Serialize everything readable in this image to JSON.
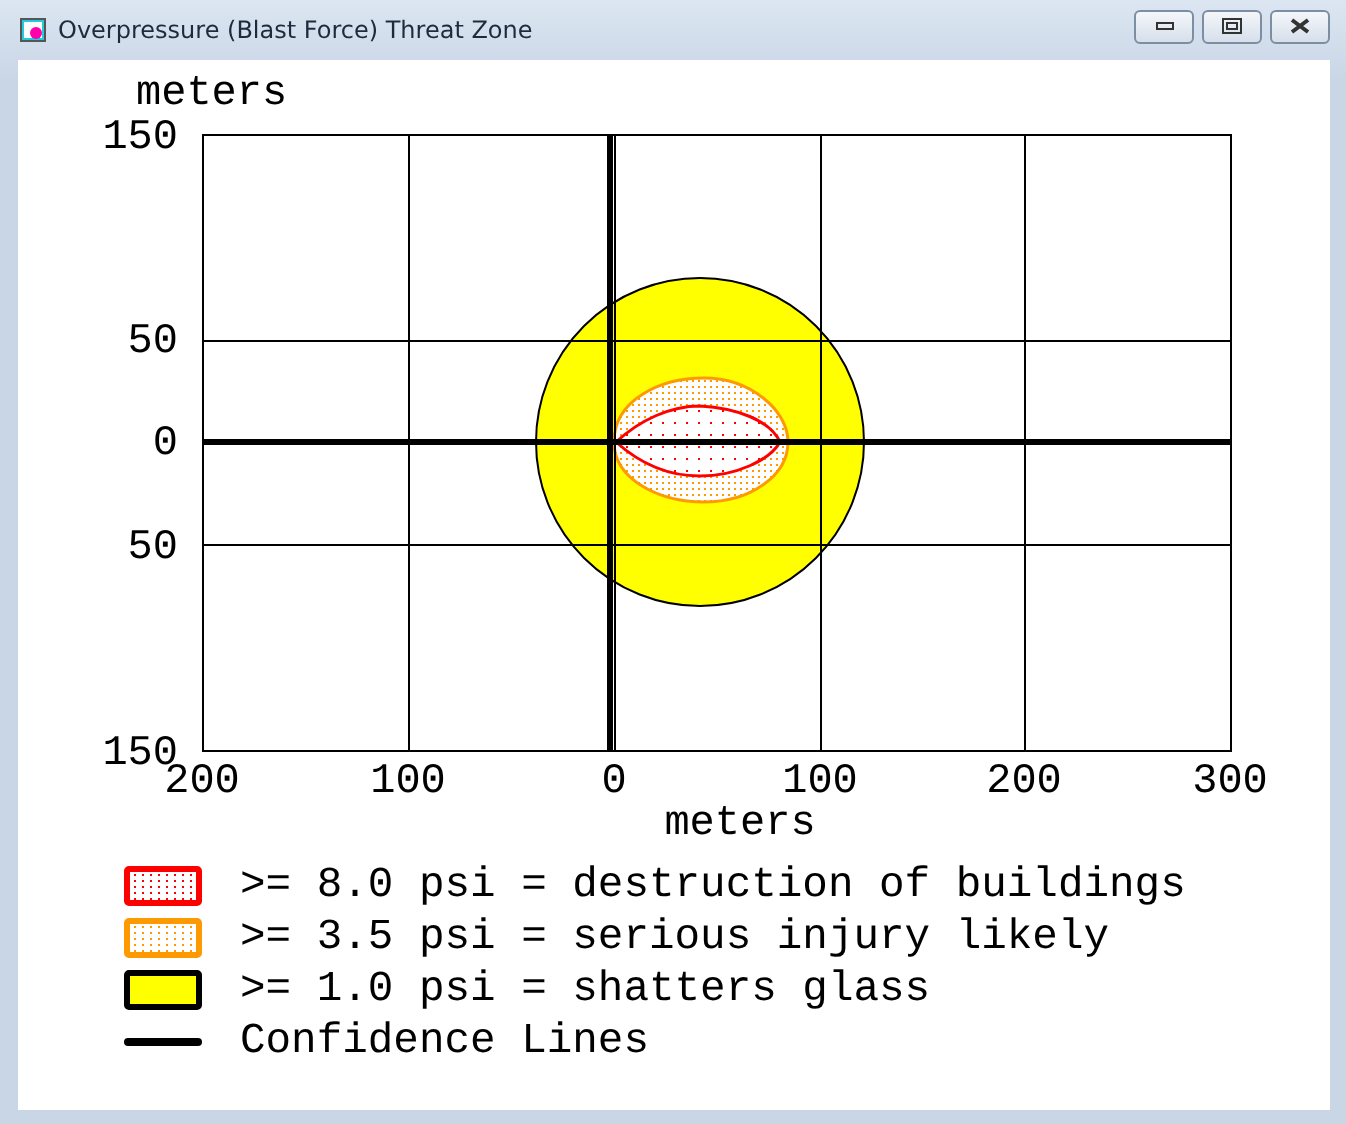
{
  "window": {
    "title": "Overpressure (Blast Force) Threat Zone"
  },
  "plot": {
    "y_axis_label": "meters",
    "x_axis_label": "meters",
    "y_tick_labels": [
      "150",
      "50",
      "0",
      "50",
      "150"
    ],
    "x_tick_labels": [
      "200",
      "100",
      "0",
      "100",
      "200",
      "300"
    ]
  },
  "legend": [
    {
      "kind": "zone",
      "dotted": true,
      "label": ">= 8.0 psi = destruction of buildings",
      "color": "#ff0000"
    },
    {
      "kind": "zone",
      "dotted": true,
      "label": ">= 3.5 psi = serious injury likely",
      "color": "#ff9900"
    },
    {
      "kind": "zone",
      "dotted": false,
      "label": ">= 1.0 psi = shatters glass",
      "color": "#ffff00"
    },
    {
      "kind": "line",
      "label": "Confidence Lines",
      "color": "#000000"
    }
  ]
}
